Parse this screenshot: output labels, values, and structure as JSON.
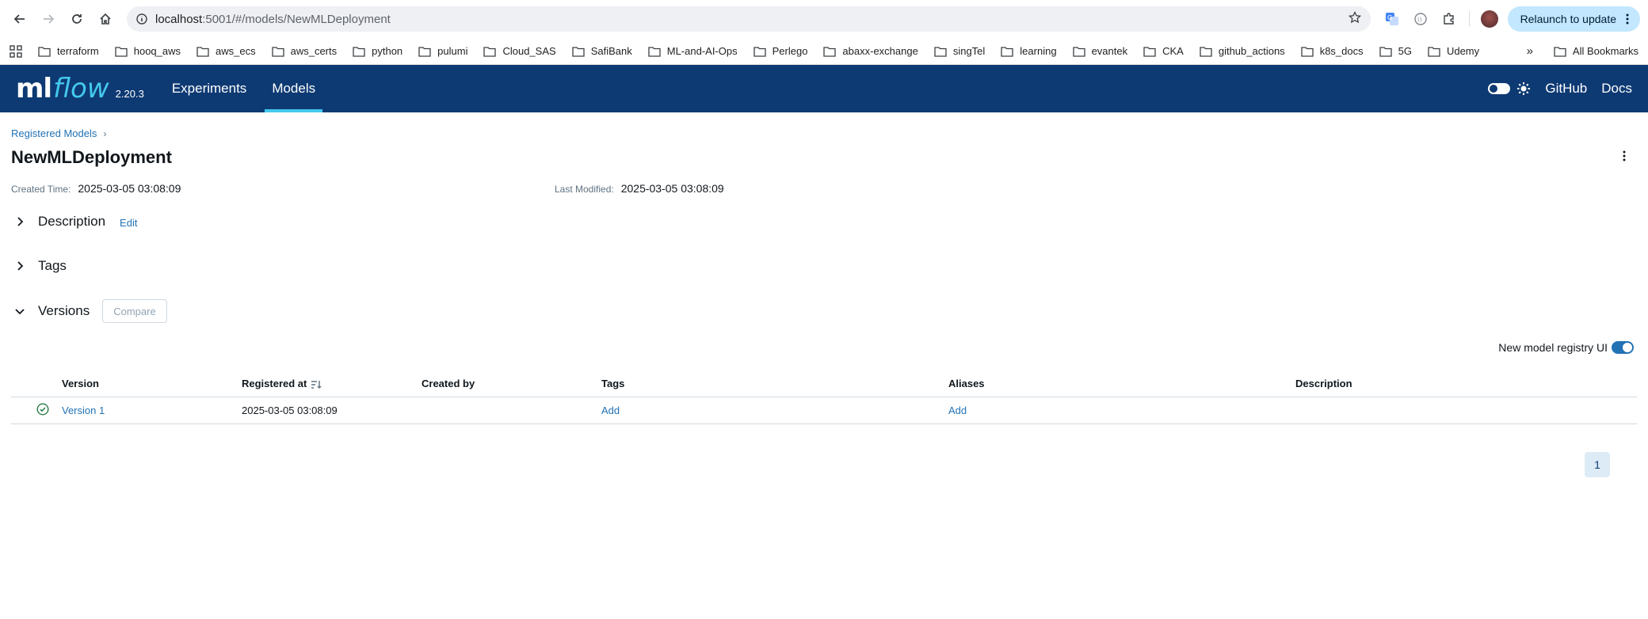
{
  "browser": {
    "url_host": "localhost",
    "url_path": ":5001/#/models/NewMLDeployment",
    "relaunch_label": "Relaunch to update",
    "bookmarks": [
      "terraform",
      "hooq_aws",
      "aws_ecs",
      "aws_certs",
      "python",
      "pulumi",
      "Cloud_SAS",
      "SafiBank",
      "ML-and-AI-Ops",
      "Perlego",
      "abaxx-exchange",
      "singTel",
      "learning",
      "evantek",
      "CKA",
      "github_actions",
      "k8s_docs",
      "5G",
      "Udemy"
    ],
    "all_bookmarks": "All Bookmarks"
  },
  "header": {
    "logo_ml": "ml",
    "logo_flow": "flow",
    "version": "2.20.3",
    "nav": [
      "Experiments",
      "Models"
    ],
    "github": "GitHub",
    "docs": "Docs",
    "accent": "#43c9ed",
    "bg": "#0e3a73"
  },
  "page": {
    "breadcrumb": "Registered Models",
    "title": "NewMLDeployment",
    "created_label": "Created Time:",
    "created_value": "2025-03-05 03:08:09",
    "modified_label": "Last Modified:",
    "modified_value": "2025-03-05 03:08:09",
    "description_label": "Description",
    "edit_label": "Edit",
    "tags_label": "Tags",
    "versions_label": "Versions",
    "compare_label": "Compare",
    "registry_ui_label": "New model registry UI"
  },
  "table": {
    "headers": [
      "Version",
      "Registered at",
      "Created by",
      "Tags",
      "Aliases",
      "Description"
    ],
    "rows": [
      {
        "version": "Version 1",
        "registered_at": "2025-03-05 03:08:09",
        "created_by": "",
        "tags": "Add",
        "aliases": "Add",
        "description": ""
      }
    ]
  },
  "pagination": {
    "current": "1"
  }
}
